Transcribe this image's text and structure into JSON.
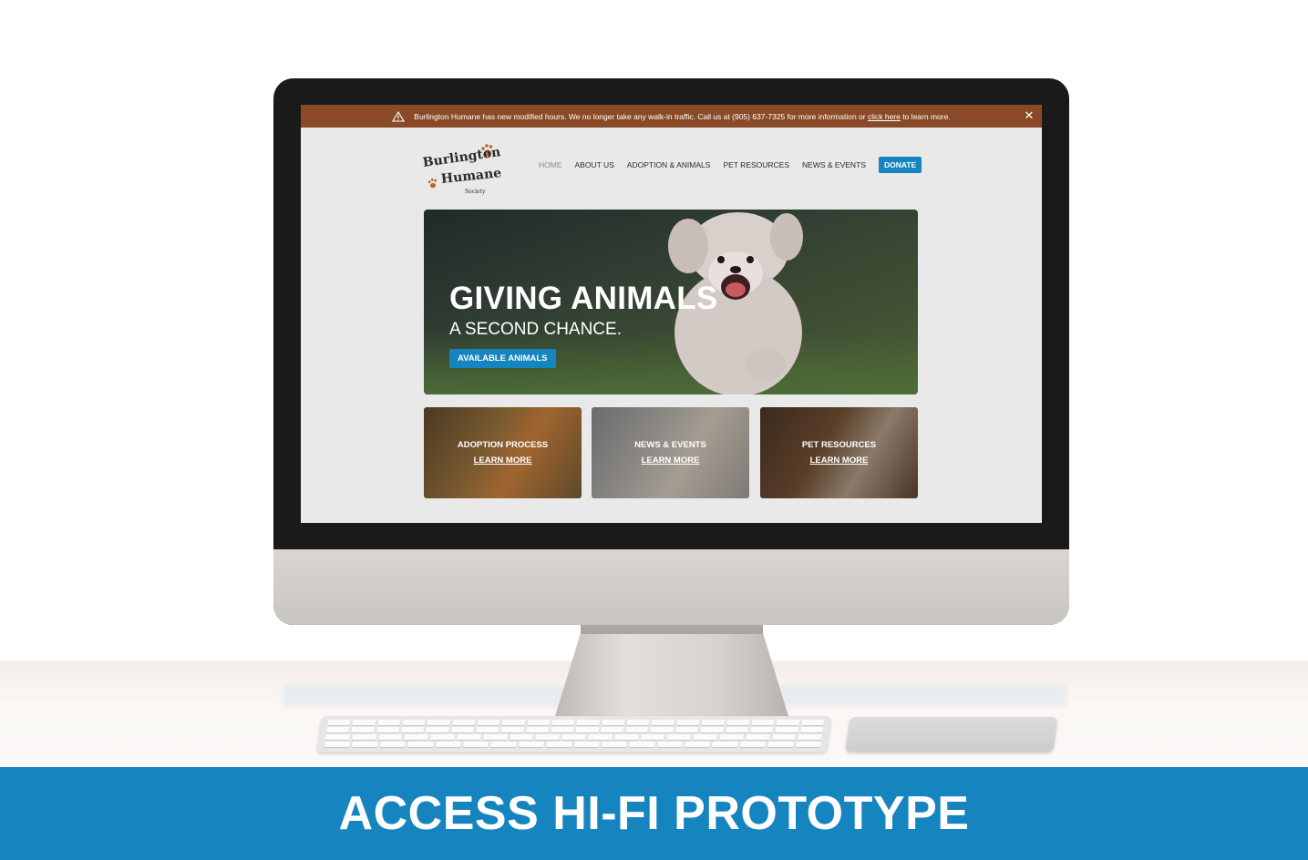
{
  "alert": {
    "text_before": "Burlington Humane has new modified hours. We no longer take any walk-in traffic. Call us at (905) 637-7325 for more information or ",
    "link_text": "click here",
    "text_after": " to learn more.",
    "close_symbol": "✕"
  },
  "logo": {
    "line1": "Burlington",
    "line2": "Humane",
    "line3": "Society"
  },
  "nav": {
    "items": [
      "HOME",
      "ABOUT US",
      "ADOPTION & ANIMALS",
      "PET RESOURCES",
      "NEWS & EVENTS"
    ],
    "donate": "DONATE"
  },
  "hero": {
    "title": "GIVING ANIMALS",
    "subtitle": "A SECOND CHANCE.",
    "button": "AVAILABLE ANIMALS"
  },
  "cards": [
    {
      "title": "ADOPTION PROCESS",
      "link": "LEARN MORE"
    },
    {
      "title": "NEWS & EVENTS",
      "link": "LEARN MORE"
    },
    {
      "title": "PET RESOURCES",
      "link": "LEARN MORE"
    }
  ],
  "footer": {
    "title": "ACCESS HI-FI PROTOTYPE"
  },
  "colors": {
    "accent": "#1584bf",
    "alert_bar": "#8a4a28",
    "screen_bg": "#e9e9e9"
  },
  "icons": [
    "warning-icon",
    "close-icon",
    "paw-icon"
  ]
}
